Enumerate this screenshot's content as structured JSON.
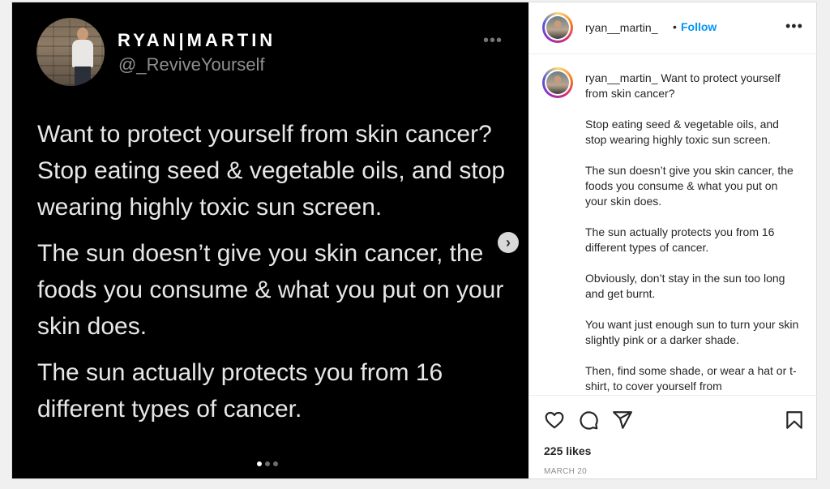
{
  "tweet": {
    "name": "RYAN|MARTIN",
    "handle": "@_ReviveYourself",
    "more": "•••",
    "paragraphs": [
      "Want to protect yourself from skin cancer? Stop eating seed & vegetable oils, and stop wearing highly toxic sun screen.",
      "The sun doesn’t give you skin cancer, the foods you consume & what you put on your skin does.",
      "The sun actually protects you from 16 different types of cancer."
    ],
    "next_glyph": "›",
    "carousel": {
      "count": 3,
      "active_index": 0
    }
  },
  "post": {
    "username": "ryan__martin_",
    "separator": "•",
    "follow_label": "Follow",
    "more": "•••",
    "caption_first": "Want to protect yourself from skin cancer?",
    "caption_paragraphs": [
      "Stop eating seed & vegetable oils, and stop wearing highly toxic sun screen.",
      "The sun doesn’t give you skin cancer, the foods you consume & what you put on your skin does.",
      "The sun actually protects you from 16 different types of cancer.",
      "Obviously, don’t stay in the sun too long and get burnt.",
      "You want just enough sun to turn your skin slightly pink or a darker shade.",
      "Then, find some shade, or wear a hat or t-shirt, to cover yourself from"
    ],
    "likes": "225 likes",
    "date": "MARCH 20"
  },
  "colors": {
    "link_blue": "#0095f6",
    "text": "#262626",
    "muted": "#8e8e8e"
  },
  "icons": [
    "heart-icon",
    "comment-icon",
    "share-icon",
    "bookmark-icon"
  ]
}
